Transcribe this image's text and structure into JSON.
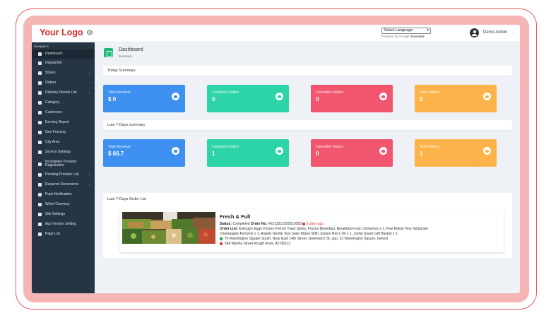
{
  "brand": {
    "logo": "Your Logo"
  },
  "header": {
    "language_select": "Select Language",
    "powered_by": "Powered by",
    "google": "Google",
    "translate": "Translate",
    "user_name": "Demo Admin"
  },
  "sidebar": {
    "heading": "Navigation",
    "items": [
      {
        "label": "Dashboard",
        "icon": "home-icon",
        "caret": ""
      },
      {
        "label": "Dispatcher",
        "icon": "dispatcher-icon",
        "caret": ""
      },
      {
        "label": "Stores",
        "icon": "store-icon",
        "caret": "›"
      },
      {
        "label": "Orders",
        "icon": "bag-icon",
        "caret": "›"
      },
      {
        "label": "Delivery Person List",
        "icon": "truck-icon",
        "caret": "›"
      },
      {
        "label": "Category",
        "icon": "list-icon",
        "caret": ""
      },
      {
        "label": "Customers",
        "icon": "users-icon",
        "caret": ""
      },
      {
        "label": "Earning Report",
        "icon": "report-icon",
        "caret": ""
      },
      {
        "label": "Geo Fencing",
        "icon": "map-icon",
        "caret": ""
      },
      {
        "label": "City Area",
        "icon": "city-icon",
        "caret": ""
      },
      {
        "label": "Service Settings",
        "icon": "gear-icon",
        "caret": "›"
      },
      {
        "label": "Incomplete Provider Registration",
        "icon": "user-x-icon",
        "caret": ""
      },
      {
        "label": "Pending Provider List",
        "icon": "pending-icon",
        "caret": "›"
      },
      {
        "label": "Required Documents",
        "icon": "document-icon",
        "caret": "›"
      },
      {
        "label": "Push Notification",
        "icon": "bell-icon",
        "caret": ""
      },
      {
        "label": "World Currency",
        "icon": "money-icon",
        "caret": ""
      },
      {
        "label": "Site Settings",
        "icon": "cog-icon",
        "caret": ""
      },
      {
        "label": "App Version Setting",
        "icon": "app-icon",
        "caret": ""
      },
      {
        "label": "Page List",
        "icon": "page-icon",
        "caret": ""
      }
    ]
  },
  "page": {
    "title": "Dashboard",
    "subtitle": "Summary"
  },
  "today": {
    "title": "Today Summary",
    "cards": [
      {
        "label": "Total Revenue",
        "value": "$ 0",
        "icon": "money-icon"
      },
      {
        "label": "Complete Orders",
        "value": "0",
        "icon": "box-icon"
      },
      {
        "label": "Cancelled Orders",
        "value": "0",
        "icon": "cart-icon"
      },
      {
        "label": "Total Orders",
        "value": "0",
        "icon": "tags-icon"
      }
    ]
  },
  "week": {
    "title": "Last 7-Days summary",
    "cards": [
      {
        "label": "Total Revenue",
        "value": "$ 66.7",
        "icon": "money-icon"
      },
      {
        "label": "Complete Orders",
        "value": "1",
        "icon": "box-icon"
      },
      {
        "label": "Cancelled Orders",
        "value": "0",
        "icon": "cart-icon"
      },
      {
        "label": "Total Orders",
        "value": "1",
        "icon": "tags-icon"
      }
    ]
  },
  "orders": {
    "title": "Last 7-Days Order List",
    "items": [
      {
        "store": "Fresh & Full",
        "status_label": "Status:",
        "status": "Completed",
        "order_no_label": "Order No:",
        "order_no": "#6313312202510018",
        "ago": "5 days ago",
        "list_label": "Order List:",
        "list_1": "Kellogg's Eggo Frozen French Toast Sticks, Frozen Breakfast, Breakfast Food, Cinnamon x 1, Five Below Very Seductive",
        "list_2": "Champagne Perfume x 1, Angels Gentle Tear Stain Wipes With Juniper Berry Oil x 1, Joyful Snack Gift Basket x 1",
        "pickup": "70 Washington Square South, Near East 14th Street, Greenwich St, opp. 33 Washington Square, behind",
        "dropoff": "584 Martha Street Rough Rock, AZ 86313"
      }
    ]
  },
  "colors": {
    "sidebar": "#263544",
    "revenue": "#3d8ff0",
    "complete": "#2dd4a7",
    "cancelled": "#f2566e",
    "total": "#fbb34a",
    "logo": "#d42a2a"
  }
}
